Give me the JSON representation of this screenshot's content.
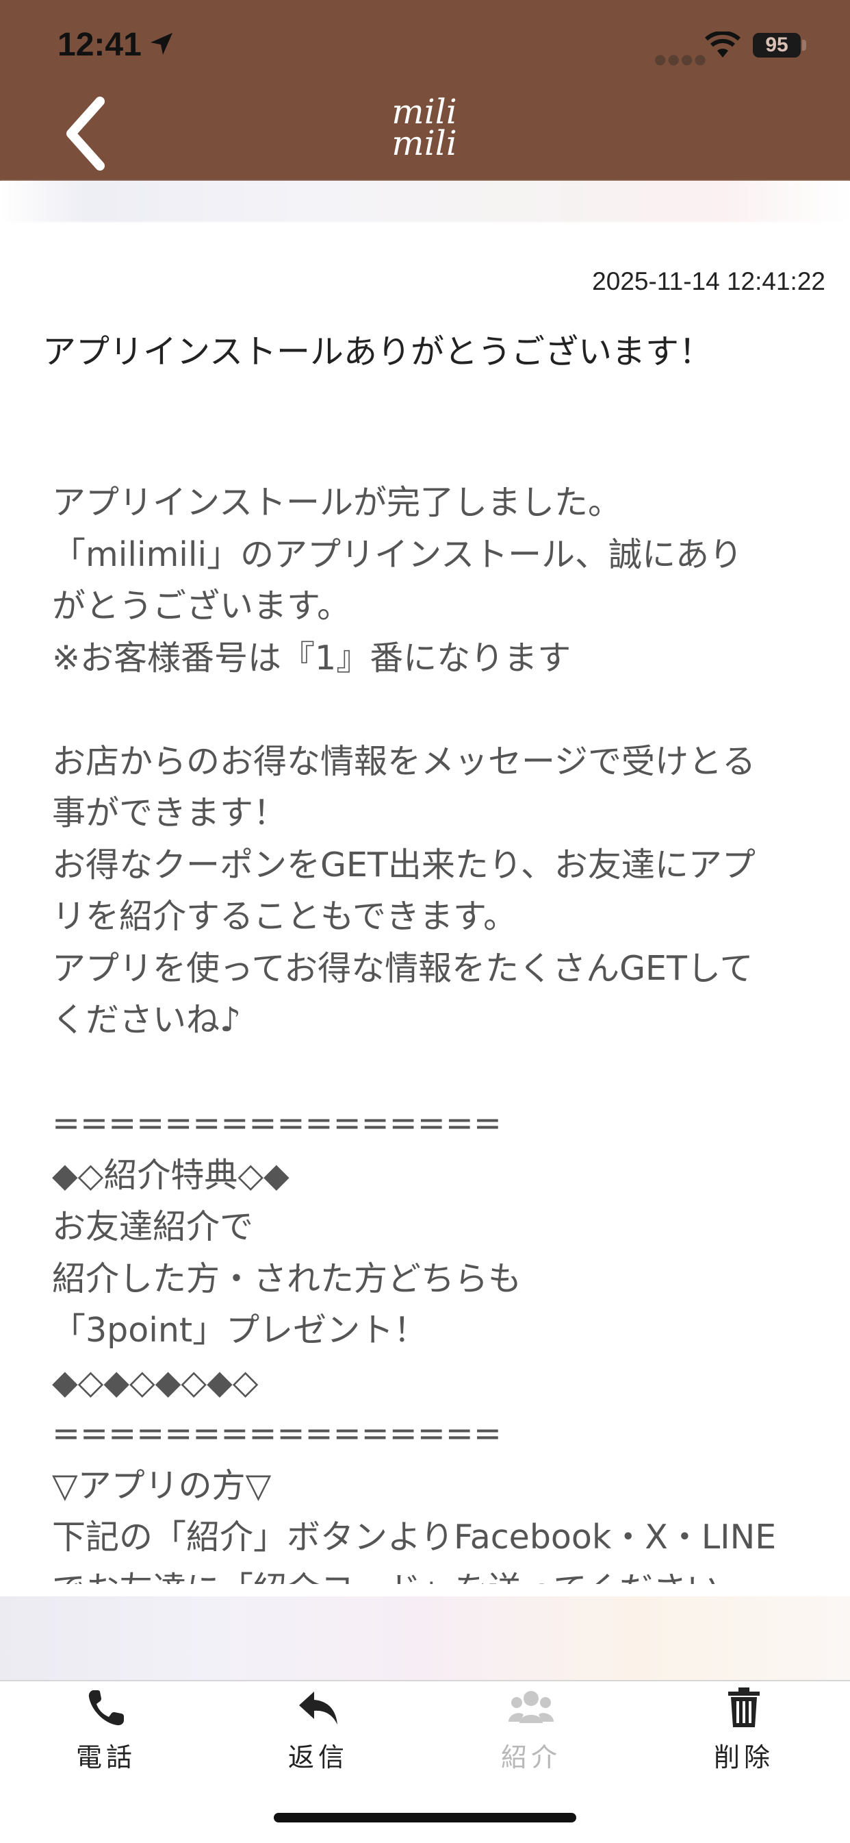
{
  "status_bar": {
    "time": "12:41",
    "battery": "95"
  },
  "header": {
    "logo_line1": "mili",
    "logo_line2": "mili"
  },
  "message": {
    "timestamp": "2025-11-14 12:41:22",
    "title": "アプリインストールありがとうございます！",
    "body": "アプリインストールが完了しました。\n「milimili」のアプリインストール、誠にあり\nがとうございます。\n※お客様番号は『1』番になります\n\nお店からのお得な情報をメッセージで受けとる\n事ができます！\nお得なクーポンをGET出来たり、お友達にアプ\nリを紹介することもできます。\nアプリを使ってお得な情報をたくさんGETして\nくださいね♪\n\n================\n◆◇紹介特典◇◆\nお友達紹介で\n紹介した方・された方どちらも\n「3point」プレゼント！\n◆◇◆◇◆◇◆◇\n================\n▽アプリの方▽\n下記の「紹介」ボタンよりFacebook・X・LINE\nでお友達に「紹介コード」を送ってください"
  },
  "tabs": [
    {
      "label": "電話",
      "icon": "phone-icon"
    },
    {
      "label": "返信",
      "icon": "reply-icon"
    },
    {
      "label": "紹介",
      "icon": "users-icon",
      "disabled": true
    },
    {
      "label": "削除",
      "icon": "trash-icon"
    }
  ],
  "colors": {
    "header": "#7a4f3c",
    "text": "#555555",
    "disabled": "#b8b8b8"
  }
}
